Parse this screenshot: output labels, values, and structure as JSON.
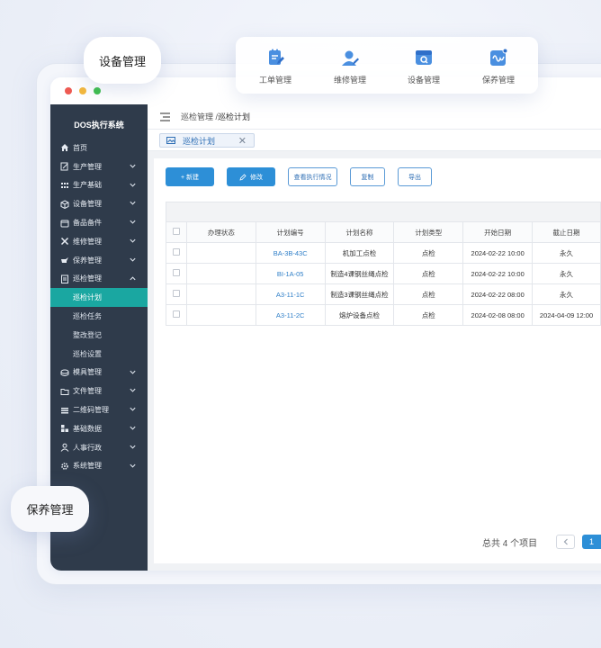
{
  "floating_labels": {
    "equipment": "设备管理",
    "maintenance": "保养管理"
  },
  "quick_bar": [
    {
      "label": "工单管理",
      "icon": "work-order-icon"
    },
    {
      "label": "维修管理",
      "icon": "repair-user-icon"
    },
    {
      "label": "设备管理",
      "icon": "device-icon"
    },
    {
      "label": "保养管理",
      "icon": "maintenance-wave-icon"
    }
  ],
  "app": {
    "title": "DOS执行系统"
  },
  "sidebar": {
    "items": [
      {
        "label": "首页",
        "icon": "home-icon"
      },
      {
        "label": "生产管理",
        "icon": "production-icon"
      },
      {
        "label": "生产基础",
        "icon": "grid-icon"
      },
      {
        "label": "设备管理",
        "icon": "box-icon"
      },
      {
        "label": "备品备件",
        "icon": "parts-icon"
      },
      {
        "label": "维修管理",
        "icon": "wrench-icon"
      },
      {
        "label": "保养管理",
        "icon": "oilcan-icon"
      },
      {
        "label": "巡检管理",
        "icon": "checklist-icon"
      }
    ],
    "sub_items": [
      {
        "label": "巡检计划",
        "active": true
      },
      {
        "label": "巡检任务"
      },
      {
        "label": "整改登记"
      },
      {
        "label": "巡检设置"
      }
    ],
    "items_after": [
      {
        "label": "模具管理",
        "icon": "mold-icon"
      },
      {
        "label": "文件管理",
        "icon": "folder-icon"
      },
      {
        "label": "二维码管理",
        "icon": "qrcode-icon"
      },
      {
        "label": "基础数据",
        "icon": "data-icon"
      },
      {
        "label": "人事行政",
        "icon": "person-icon"
      },
      {
        "label": "系统管理",
        "icon": "settings-icon"
      }
    ]
  },
  "header": {
    "breadcrumb_parent": "巡检管理",
    "breadcrumb_separator": " /",
    "breadcrumb_current": "巡检计划"
  },
  "tabs": [
    {
      "label": "巡检计划"
    }
  ],
  "toolbar": {
    "new_label": "+ 新建",
    "edit_label": "修改",
    "view_exec_label": "查看执行情况",
    "copy_label": "复制",
    "export_label": "导出"
  },
  "table": {
    "columns": [
      "办理状态",
      "计划编号",
      "计划名称",
      "计划类型",
      "开始日期",
      "截止日期"
    ],
    "rows": [
      {
        "status": "",
        "code": "BA-3B-43C",
        "name": "机加工点检",
        "type": "点检",
        "start": "2024-02-22 10:00",
        "end": "永久"
      },
      {
        "status": "",
        "code": "BI-1A-05",
        "name": "制造4课钢丝绳点检",
        "type": "点检",
        "start": "2024-02-22 10:00",
        "end": "永久"
      },
      {
        "status": "",
        "code": "A3-11-1C",
        "name": "制造3课钢丝绳点检",
        "type": "点检",
        "start": "2024-02-22 08:00",
        "end": "永久"
      },
      {
        "status": "",
        "code": "A3-11-2C",
        "name": "熔炉设备点检",
        "type": "点检",
        "start": "2024-02-08 08:00",
        "end": "2024-04-09 12:00"
      }
    ]
  },
  "pagination": {
    "total_text": "总共 4 个项目",
    "current_page": "1"
  },
  "colors": {
    "sidebar_bg": "#2f3b4b",
    "active_item": "#1aa7a1",
    "primary": "#2d8fd7",
    "link": "#2f7fc8"
  }
}
